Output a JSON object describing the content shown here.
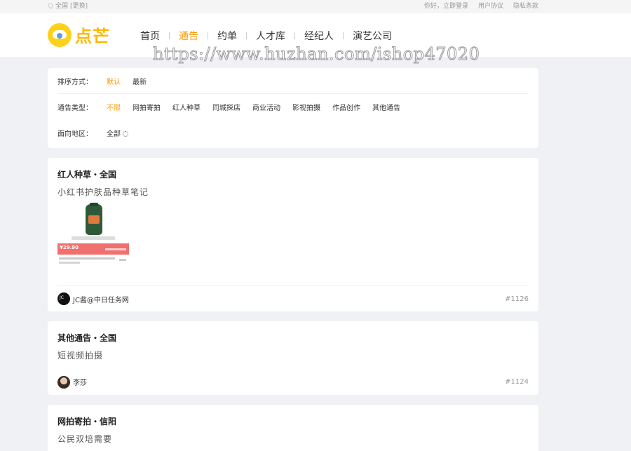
{
  "topbar": {
    "location": "全国",
    "switch": "[更换]",
    "greeting": "你好，立即登录",
    "agreement": "用户协议",
    "privacy": "隐私条款"
  },
  "header": {
    "logo_text": "点芒",
    "nav": [
      {
        "label": "首页"
      },
      {
        "label": "通告"
      },
      {
        "label": "约单"
      },
      {
        "label": "人才库"
      },
      {
        "label": "经纪人"
      },
      {
        "label": "演艺公司"
      }
    ]
  },
  "watermark": "https://www.huzhan.com/ishop47020",
  "filters": {
    "sort_label": "排序方式：",
    "sort_options": [
      "默认",
      "最新"
    ],
    "type_label": "通告类型：",
    "type_options": [
      "不限",
      "网拍寄拍",
      "红人种草",
      "同城探店",
      "商业活动",
      "影视拍摄",
      "作品创作",
      "其他通告"
    ],
    "region_label": "面向地区：",
    "region_value": "全部"
  },
  "posts": [
    {
      "title": "红人种草・全国",
      "desc": "小红书护肤品种草笔记",
      "thumb_price": "¥29.90",
      "user": "JC酱@中日任务网",
      "number": "#1126"
    },
    {
      "title": "其他通告・全国",
      "desc": "短视频拍摄",
      "user": "李莎",
      "number": "#1124"
    },
    {
      "title": "网拍寄拍・信阳",
      "desc": "公民双培需要"
    }
  ],
  "colors": {
    "accent": "#ff9900",
    "logo": "#ffb800",
    "page_bg": "#f0f1f5"
  }
}
